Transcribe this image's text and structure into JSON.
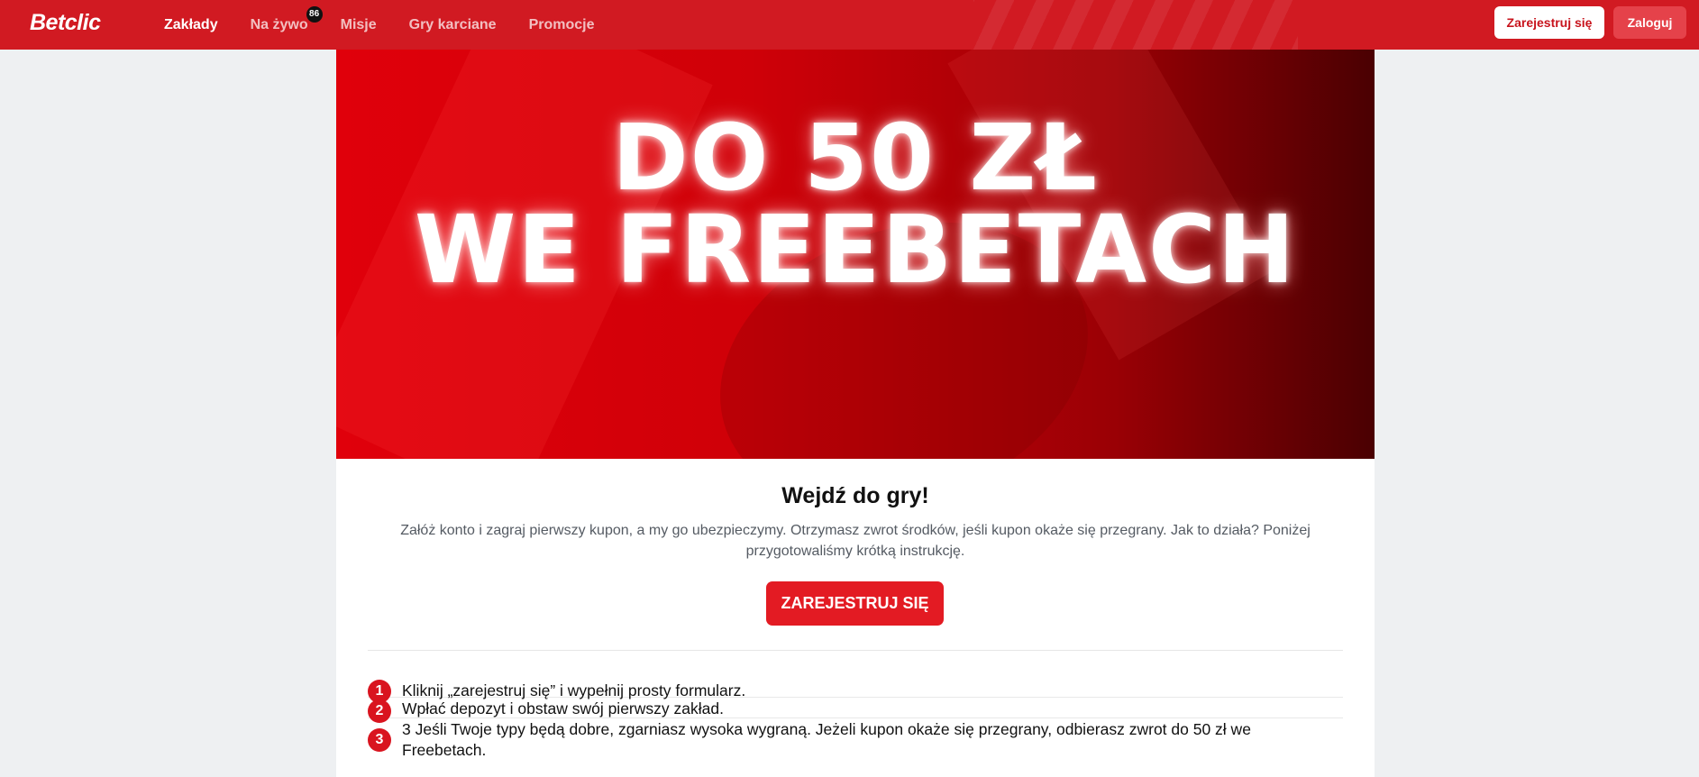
{
  "header": {
    "logo": "Betclic",
    "nav": [
      {
        "label": "Zakłady",
        "active": true
      },
      {
        "label": "Na żywo",
        "badge": "86",
        "active": false
      },
      {
        "label": "Misje",
        "active": false
      },
      {
        "label": "Gry karciane",
        "active": false
      },
      {
        "label": "Promocje",
        "active": false
      }
    ],
    "register_label": "Zarejestruj się",
    "login_label": "Zaloguj"
  },
  "hero": {
    "line1": "DO 50 ZŁ",
    "line2": "WE FREEBETACH"
  },
  "main": {
    "title": "Wejdź do gry!",
    "description": "Załóż konto i zagraj pierwszy kupon, a my go ubezpieczymy. Otrzymasz zwrot środków, jeśli kupon okaże się przegrany. Jak to działa? Poniżej przygotowaliśmy krótką instrukcję.",
    "cta_label": "ZAREJESTRUJ SIĘ",
    "steps": [
      {
        "number": "1",
        "text": "Kliknij „zarejestruj się” i wypełnij prosty formularz."
      },
      {
        "number": "2",
        "text": "Wpłać depozyt i obstaw swój pierwszy zakład."
      },
      {
        "number": "3",
        "text": "3 Jeśli Twoje typy będą dobre, zgarniasz wysoka wygraną. Jeżeli kupon okaże się przegrany, odbierasz zwrot do 50 zł we Freebetach."
      }
    ]
  },
  "colors": {
    "brand_red": "#d11a22",
    "cta_red": "#e31b23",
    "page_bg": "#eef0f2"
  }
}
